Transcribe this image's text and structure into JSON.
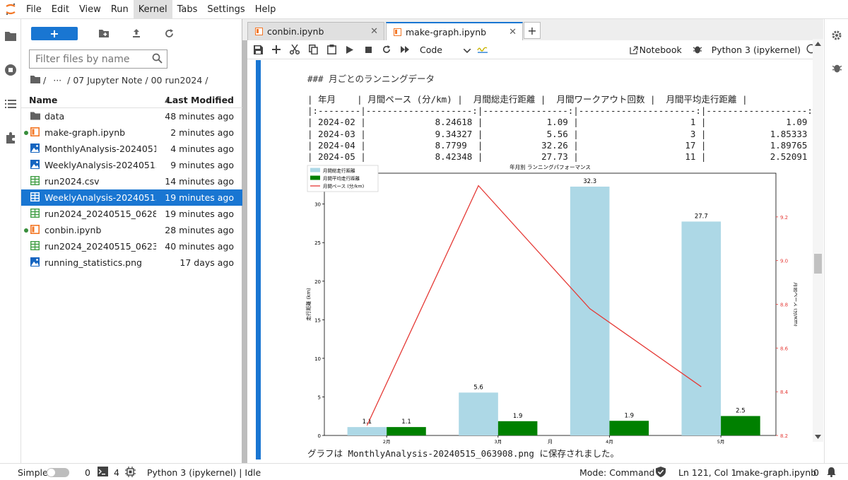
{
  "menubar": {
    "items": [
      "File",
      "Edit",
      "View",
      "Run",
      "Kernel",
      "Tabs",
      "Settings",
      "Help"
    ],
    "active_index": 4
  },
  "filebrowser": {
    "new_label": "+",
    "filter_placeholder": "Filter files by name",
    "breadcrumb": [
      "/",
      "···",
      "/ 07 Jupyter Note / 00 run2024 /"
    ],
    "header": {
      "name": "Name",
      "modified": "Last Modified"
    },
    "files": [
      {
        "name": "data",
        "modified": "48 minutes ago",
        "type": "folder",
        "running": false,
        "selected": false
      },
      {
        "name": "make-graph.ipynb",
        "modified": "2 minutes ago",
        "type": "notebook",
        "running": true,
        "selected": false
      },
      {
        "name": "MonthlyAnalysis-20240515...",
        "modified": "4 minutes ago",
        "type": "image",
        "running": false,
        "selected": false
      },
      {
        "name": "WeeklyAnalysis-20240515_...",
        "modified": "9 minutes ago",
        "type": "image",
        "running": false,
        "selected": false
      },
      {
        "name": "run2024.csv",
        "modified": "14 minutes ago",
        "type": "csv",
        "running": false,
        "selected": false
      },
      {
        "name": "WeeklyAnalysis-20240515_...",
        "modified": "19 minutes ago",
        "type": "csv",
        "running": false,
        "selected": true
      },
      {
        "name": "run2024_20240515_062834...",
        "modified": "19 minutes ago",
        "type": "csv",
        "running": false,
        "selected": false
      },
      {
        "name": "conbin.ipynb",
        "modified": "28 minutes ago",
        "type": "notebook",
        "running": true,
        "selected": false
      },
      {
        "name": "run2024_20240515_062353...",
        "modified": "40 minutes ago",
        "type": "csv",
        "running": false,
        "selected": false
      },
      {
        "name": "running_statistics.png",
        "modified": "17 days ago",
        "type": "image",
        "running": false,
        "selected": false
      }
    ]
  },
  "tabs": [
    {
      "label": "conbin.ipynb",
      "active": false
    },
    {
      "label": "make-graph.ipynb",
      "active": true
    }
  ],
  "toolbar": {
    "cell_type": "Code",
    "notebook_label": "Notebook",
    "kernel_label": "Python 3 (ipykernel)"
  },
  "notebook": {
    "heading": "### 月ごとのランニングデータ",
    "table_lines": [
      "| 年月    | 月間ペース (分/km) |  月間総走行距離 |  月間ワークアウト回数 |  月間平均走行距離 |",
      "|:--------|--------------------:|----------------:|----------------------:|-------------------:|",
      "| 2024-02 |             8.24618 |            1.09 |                     1 |               1.09 |",
      "| 2024-03 |             9.34327 |            5.56 |                     3 |            1.85333 |",
      "| 2024-04 |             8.7799  |           32.26 |                    17 |            1.89765 |",
      "| 2024-05 |             8.42348 |           27.73 |                    11 |            2.52091 |"
    ],
    "saved_message": "グラフは MonthlyAnalysis-20240515_063908.png に保存されました。"
  },
  "chart_data": {
    "type": "bar",
    "title": "年月別 ランニングパフォーマンス",
    "xlabel": "月",
    "ylabel": "走行距離 (km)",
    "y2label": "月間ペース (分/km)",
    "categories": [
      "2月",
      "3月",
      "4月",
      "5月"
    ],
    "ylim": [
      0,
      34
    ],
    "y2lim": [
      8.2,
      9.4
    ],
    "yticks": [
      0,
      5,
      10,
      15,
      20,
      25,
      30
    ],
    "y2ticks": [
      8.2,
      8.4,
      8.6,
      8.8,
      9.0,
      9.2
    ],
    "legend_position": "top-left",
    "grid": false,
    "series": [
      {
        "name": "月間総走行距離",
        "type": "bar",
        "color": "#add8e6",
        "values": [
          1.09,
          5.56,
          32.26,
          27.73
        ],
        "labels": [
          "1.1",
          "5.6",
          "32.3",
          "27.7"
        ]
      },
      {
        "name": "月間平均走行距離",
        "type": "bar",
        "color": "#008000",
        "values": [
          1.09,
          1.85,
          1.9,
          2.52
        ],
        "labels": [
          "1.1",
          "1.9",
          "1.9",
          "2.5"
        ]
      },
      {
        "name": "月間ペース (分/km)",
        "type": "line",
        "axis": "right",
        "color": "#e53935",
        "values": [
          8.246,
          9.343,
          8.78,
          8.423
        ]
      }
    ]
  },
  "statusbar": {
    "mode_label": "Simple",
    "terminals": "0",
    "kernels": "4",
    "kernel_status": "Python 3 (ipykernel) | Idle",
    "command_mode": "Mode: Command",
    "position": "Ln 121, Col 1",
    "filename": "make-graph.ipynb",
    "notifications": "0"
  },
  "colors": {
    "accent": "#1976d2",
    "notebook_orange": "#f37726",
    "running_green": "#388e3c"
  }
}
